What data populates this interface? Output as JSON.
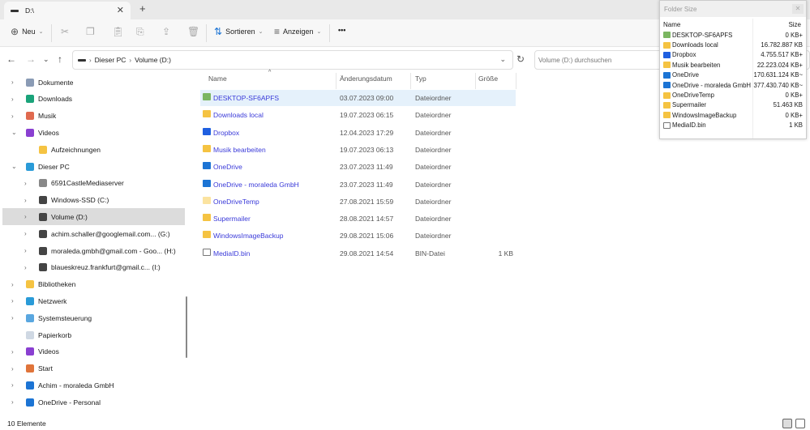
{
  "tab": {
    "title": "D:\\",
    "close": "✕",
    "new": "+"
  },
  "toolbar": {
    "new": "Neu",
    "sort": "Sortieren",
    "view": "Anzeigen",
    "more": "•••"
  },
  "address": {
    "crumbs": [
      "Dieser PC",
      "Volume (D:)"
    ],
    "search_placeholder": "Volume (D:) durchsuchen"
  },
  "nav": [
    {
      "label": "Dokumente",
      "arrow": "›",
      "level": 0,
      "color": "#8a9bb5"
    },
    {
      "label": "Downloads",
      "arrow": "›",
      "level": 0,
      "color": "#1aa37a"
    },
    {
      "label": "Musik",
      "arrow": "›",
      "level": 0,
      "color": "#e06a4f"
    },
    {
      "label": "Videos",
      "arrow": "⌄",
      "level": 0,
      "color": "#8a3fd1"
    },
    {
      "label": "Aufzeichnungen",
      "arrow": "",
      "level": 1,
      "color": "#f5c342"
    },
    {
      "label": "Dieser PC",
      "arrow": "⌄",
      "level": 0,
      "color": "#2a9bd8"
    },
    {
      "label": "6591CastleMediaserver",
      "arrow": "›",
      "level": 1,
      "color": "#888"
    },
    {
      "label": "Windows-SSD (C:)",
      "arrow": "›",
      "level": 1,
      "color": "#444"
    },
    {
      "label": "Volume (D:)",
      "arrow": "›",
      "level": 1,
      "color": "#444",
      "selected": true
    },
    {
      "label": "achim.schaller@googlemail.com... (G:)",
      "arrow": "›",
      "level": 1,
      "color": "#444"
    },
    {
      "label": "moraleda.gmbh@gmail.com - Goo... (H:)",
      "arrow": "›",
      "level": 1,
      "color": "#444"
    },
    {
      "label": "blaueskreuz.frankfurt@gmail.c... (I:)",
      "arrow": "›",
      "level": 1,
      "color": "#444"
    },
    {
      "label": "Bibliotheken",
      "arrow": "›",
      "level": 0,
      "color": "#f5c342"
    },
    {
      "label": "Netzwerk",
      "arrow": "›",
      "level": 0,
      "color": "#2a9bd8"
    },
    {
      "label": "Systemsteuerung",
      "arrow": "›",
      "level": 0,
      "color": "#5aa7e0"
    },
    {
      "label": "Papierkorb",
      "arrow": "",
      "level": 0,
      "color": "#cfd8e3"
    },
    {
      "label": "Videos",
      "arrow": "›",
      "level": 0,
      "color": "#8a3fd1"
    },
    {
      "label": "Start",
      "arrow": "›",
      "level": 0,
      "color": "#e0743a"
    },
    {
      "label": "Achim - moraleda GmbH",
      "arrow": "›",
      "level": 0,
      "color": "#1c74d4"
    },
    {
      "label": "OneDrive - Personal",
      "arrow": "›",
      "level": 0,
      "color": "#1c74d4"
    }
  ],
  "columns": {
    "name": "Name",
    "date": "Änderungsdatum",
    "type": "Typ",
    "size": "Größe"
  },
  "files": [
    {
      "name": "DESKTOP-SF6APFS",
      "date": "03.07.2023 09:00",
      "type": "Dateiordner",
      "size": "",
      "color": "#7bb661"
    },
    {
      "name": "Downloads local",
      "date": "19.07.2023 06:15",
      "type": "Dateiordner",
      "size": "",
      "color": "#f5c342"
    },
    {
      "name": "Dropbox",
      "date": "12.04.2023 17:29",
      "type": "Dateiordner",
      "size": "",
      "color": "#1f5fe0"
    },
    {
      "name": "Musik bearbeiten",
      "date": "19.07.2023 06:13",
      "type": "Dateiordner",
      "size": "",
      "color": "#f5c342"
    },
    {
      "name": "OneDrive",
      "date": "23.07.2023 11:49",
      "type": "Dateiordner",
      "size": "",
      "color": "#1c74d4"
    },
    {
      "name": "OneDrive - moraleda GmbH",
      "date": "23.07.2023 11:49",
      "type": "Dateiordner",
      "size": "",
      "color": "#1c74d4"
    },
    {
      "name": "OneDriveTemp",
      "date": "27.08.2021 15:59",
      "type": "Dateiordner",
      "size": "",
      "color": "#fbe3a0"
    },
    {
      "name": "Supermailer",
      "date": "28.08.2021 14:57",
      "type": "Dateiordner",
      "size": "",
      "color": "#f5c342"
    },
    {
      "name": "WindowsImageBackup",
      "date": "29.08.2021 15:06",
      "type": "Dateiordner",
      "size": "",
      "color": "#f5c342"
    },
    {
      "name": "MediaID.bin",
      "date": "29.08.2021 14:54",
      "type": "BIN-Datei",
      "size": "1 KB",
      "color": "#ffffff"
    }
  ],
  "status": "10 Elemente",
  "folder_size": {
    "title": "Folder Size",
    "close": "✕",
    "col_name": "Name",
    "col_size": "Size",
    "rows": [
      {
        "name": "DESKTOP-SF6APFS",
        "size": "0 KB+",
        "color": "#7bb661"
      },
      {
        "name": "Downloads local",
        "size": "16.782.887 KB",
        "color": "#f5c342"
      },
      {
        "name": "Dropbox",
        "size": "4.755.517 KB+",
        "color": "#1f5fe0"
      },
      {
        "name": "Musik bearbeiten",
        "size": "22.223.024 KB+",
        "color": "#f5c342"
      },
      {
        "name": "OneDrive",
        "size": "170.631.124 KB~",
        "color": "#1c74d4"
      },
      {
        "name": "OneDrive - moraleda GmbH",
        "size": "377.430.740 KB~",
        "color": "#1c74d4"
      },
      {
        "name": "OneDriveTemp",
        "size": "0 KB+",
        "color": "#f5c342"
      },
      {
        "name": "Supermailer",
        "size": "51.463 KB",
        "color": "#f5c342"
      },
      {
        "name": "WindowsImageBackup",
        "size": "0 KB+",
        "color": "#f5c342"
      },
      {
        "name": "MediaID.bin",
        "size": "1 KB",
        "color": "#ffffff"
      }
    ]
  }
}
